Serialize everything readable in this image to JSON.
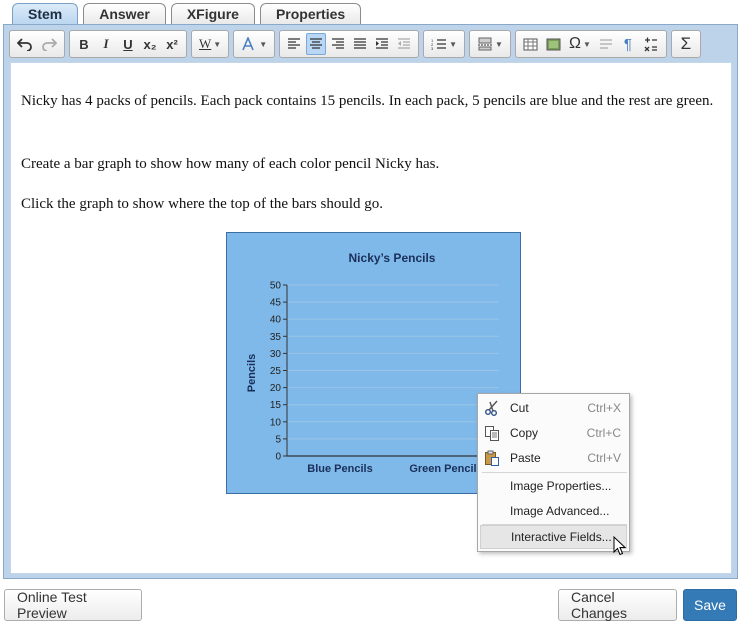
{
  "tabs": [
    {
      "label": "Stem",
      "active": true
    },
    {
      "label": "Answer",
      "active": false
    },
    {
      "label": "XFigure",
      "active": false
    },
    {
      "label": "Properties",
      "active": false
    }
  ],
  "toolbar": {
    "bold": "B",
    "italic": "I",
    "underline": "U",
    "subscript": "x₂",
    "superscript": "x²",
    "word_style": "W",
    "omega": "Ω",
    "sigma": "Σ",
    "pilcrow": "¶"
  },
  "stem": {
    "p1": "Nicky has 4 packs of pencils. Each pack contains 15 pencils. In each pack, 5 pencils are blue and the rest are green.",
    "p2": "Create a bar graph to show how many of each color pencil Nicky has.",
    "p3": "Click the graph to show where the top of the bars should go."
  },
  "chart_data": {
    "type": "bar",
    "title": "Nicky’s Pencils",
    "ylabel": "Pencils",
    "xlabel": "",
    "categories": [
      "Blue Pencils",
      "Green Pencils"
    ],
    "values": [],
    "ylim": [
      0,
      50
    ],
    "yticks": [
      "0",
      "5",
      "10",
      "15",
      "20",
      "25",
      "30",
      "35",
      "40",
      "45",
      "50"
    ],
    "grid": true,
    "colors": {
      "background": "#7fb9ea",
      "gridline": "#9cc4e4",
      "axis": "#333333",
      "text": "#1a2f5a"
    }
  },
  "context_menu": {
    "cut": {
      "label": "Cut",
      "shortcut": "Ctrl+X"
    },
    "copy": {
      "label": "Copy",
      "shortcut": "Ctrl+C"
    },
    "paste": {
      "label": "Paste",
      "shortcut": "Ctrl+V"
    },
    "image_properties": "Image Properties...",
    "image_advanced": "Image Advanced...",
    "interactive_fields": "Interactive Fields..."
  },
  "buttons": {
    "preview": "Online Test Preview",
    "cancel": "Cancel Changes",
    "save": "Save"
  },
  "colors": {
    "accent": "#337ab7",
    "tab_active": "#b9d6ef",
    "frame": "#bcd3ea"
  }
}
